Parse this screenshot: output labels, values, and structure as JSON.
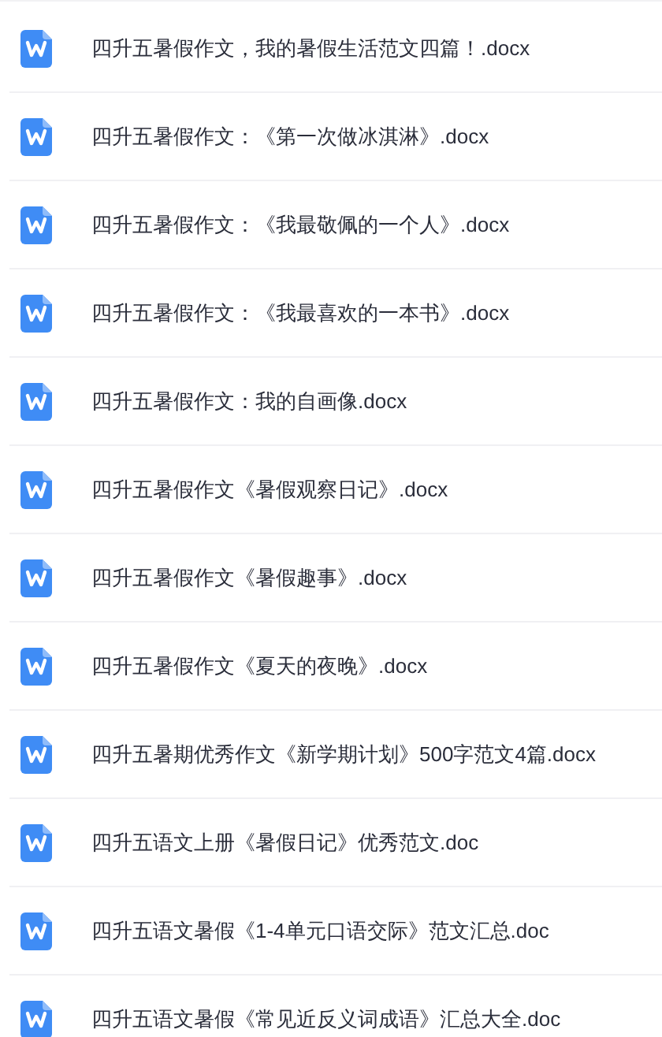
{
  "files": [
    {
      "name": "四升五暑假作文，我的暑假生活范文四篇！.docx"
    },
    {
      "name": "四升五暑假作文：《第一次做冰淇淋》.docx"
    },
    {
      "name": "四升五暑假作文：《我最敬佩的一个人》.docx"
    },
    {
      "name": "四升五暑假作文：《我最喜欢的一本书》.docx"
    },
    {
      "name": "四升五暑假作文：我的自画像.docx"
    },
    {
      "name": "四升五暑假作文《暑假观察日记》.docx"
    },
    {
      "name": "四升五暑假作文《暑假趣事》.docx"
    },
    {
      "name": "四升五暑假作文《夏天的夜晚》.docx"
    },
    {
      "name": "四升五暑期优秀作文《新学期计划》500字范文4篇.docx"
    },
    {
      "name": "四升五语文上册《暑假日记》优秀范文.doc"
    },
    {
      "name": "四升五语文暑假《1-4单元口语交际》范文汇总.doc"
    },
    {
      "name": "四升五语文暑假《常见近反义词成语》汇总大全.doc"
    }
  ]
}
